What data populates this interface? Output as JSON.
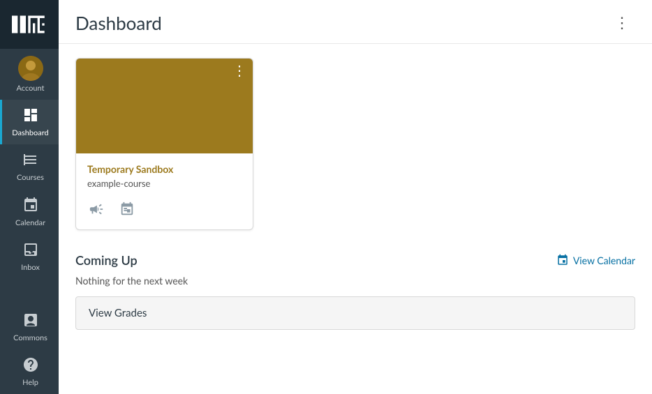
{
  "sidebar": {
    "logo_alt": "MIT Logo",
    "items": [
      {
        "id": "account",
        "label": "Account",
        "icon": "👤",
        "active": false
      },
      {
        "id": "dashboard",
        "label": "Dashboard",
        "icon": "🏠",
        "active": true
      },
      {
        "id": "courses",
        "label": "Courses",
        "icon": "📋",
        "active": false
      },
      {
        "id": "calendar",
        "label": "Calendar",
        "icon": "📅",
        "active": false
      },
      {
        "id": "inbox",
        "label": "Inbox",
        "icon": "📥",
        "active": false
      },
      {
        "id": "commons",
        "label": "Commons",
        "icon": "↗",
        "active": false
      },
      {
        "id": "help",
        "label": "Help",
        "icon": "❓",
        "active": false
      }
    ]
  },
  "header": {
    "title": "Dashboard",
    "menu_button_label": "⋮"
  },
  "course_card": {
    "title": "Temporary Sandbox",
    "subtitle": "example-course",
    "image_color": "#9c7a1e",
    "menu_dots": "⋮"
  },
  "coming_up": {
    "title": "Coming Up",
    "view_calendar_label": "View Calendar",
    "empty_message": "Nothing for the next week",
    "view_grades_label": "View Grades"
  }
}
